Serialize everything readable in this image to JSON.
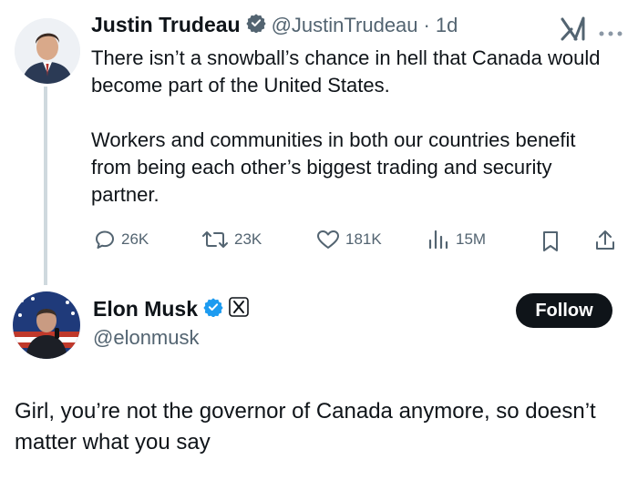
{
  "tweet": {
    "author_name": "Justin Trudeau",
    "handle": "@JustinTrudeau",
    "separator": "·",
    "time": "1d",
    "text": "There isn’t a snowball’s chance in hell that Canada would become part of the United States.\n\nWorkers and communities in both our countries benefit from being each other’s biggest trading and security partner.",
    "actions": {
      "replies": "26K",
      "reposts": "23K",
      "likes": "181K",
      "views": "15M"
    },
    "icons": [
      "verified-badge-icon",
      "grok-icon",
      "more-icon",
      "reply-icon",
      "repost-icon",
      "like-icon",
      "views-icon",
      "bookmark-icon",
      "share-icon"
    ]
  },
  "reply": {
    "author_name": "Elon Musk",
    "handle": "@elonmusk",
    "follow_label": "Follow",
    "text": "Girl, you’re not the governor of Canada anymore, so doesn’t matter what you say"
  },
  "colors": {
    "text": "#0f1419",
    "muted": "#536471",
    "verified": "#1d9bf0",
    "thread_line": "#cfd9de",
    "follow_bg": "#0f1419"
  }
}
